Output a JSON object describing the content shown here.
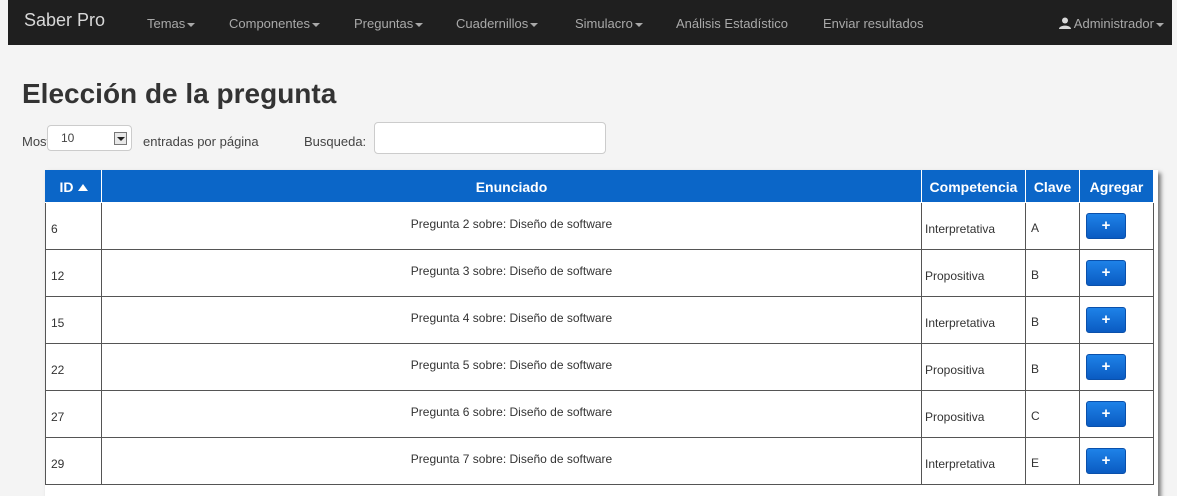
{
  "navbar": {
    "brand": "Saber Pro",
    "items": [
      {
        "label": "Temas",
        "has_caret": true
      },
      {
        "label": "Componentes",
        "has_caret": true
      },
      {
        "label": "Preguntas",
        "has_caret": true
      },
      {
        "label": "Cuadernillos",
        "has_caret": true
      },
      {
        "label": "Simulacro",
        "has_caret": true
      },
      {
        "label": "Análisis Estadístico",
        "has_caret": false
      },
      {
        "label": "Enviar resultados",
        "has_caret": false
      }
    ],
    "user": {
      "label": "Administrador",
      "icon": "user-icon"
    }
  },
  "page": {
    "title": "Elección de la pregunta"
  },
  "controls": {
    "show_label": "Mostrar",
    "length_value": "10",
    "entries_label": "entradas por página",
    "search_label": "Busqueda:",
    "search_value": ""
  },
  "table": {
    "headers": {
      "id": "ID",
      "enunciado": "Enunciado",
      "competencia": "Competencia",
      "clave": "Clave",
      "agregar": "Agregar"
    },
    "sort": {
      "column": "id",
      "direction": "ascending"
    },
    "add_button_label": "+",
    "rows": [
      {
        "id": "6",
        "enunciado": "Pregunta 2 sobre: Diseño de software",
        "competencia": "Interpretativa",
        "clave": "A"
      },
      {
        "id": "12",
        "enunciado": "Pregunta 3 sobre: Diseño de software",
        "competencia": "Propositiva",
        "clave": "B"
      },
      {
        "id": "15",
        "enunciado": "Pregunta 4 sobre: Diseño de software",
        "competencia": "Interpretativa",
        "clave": "B"
      },
      {
        "id": "22",
        "enunciado": "Pregunta 5 sobre: Diseño de software",
        "competencia": "Propositiva",
        "clave": "B"
      },
      {
        "id": "27",
        "enunciado": "Pregunta 6 sobre: Diseño de software",
        "competencia": "Propositiva",
        "clave": "C"
      },
      {
        "id": "29",
        "enunciado": "Pregunta 7 sobre: Diseño de software",
        "competencia": "Interpretativa",
        "clave": "E"
      }
    ]
  },
  "colors": {
    "navbar": "#1f1f1f",
    "header": "#0b66c8",
    "button": "#1a74dc"
  }
}
